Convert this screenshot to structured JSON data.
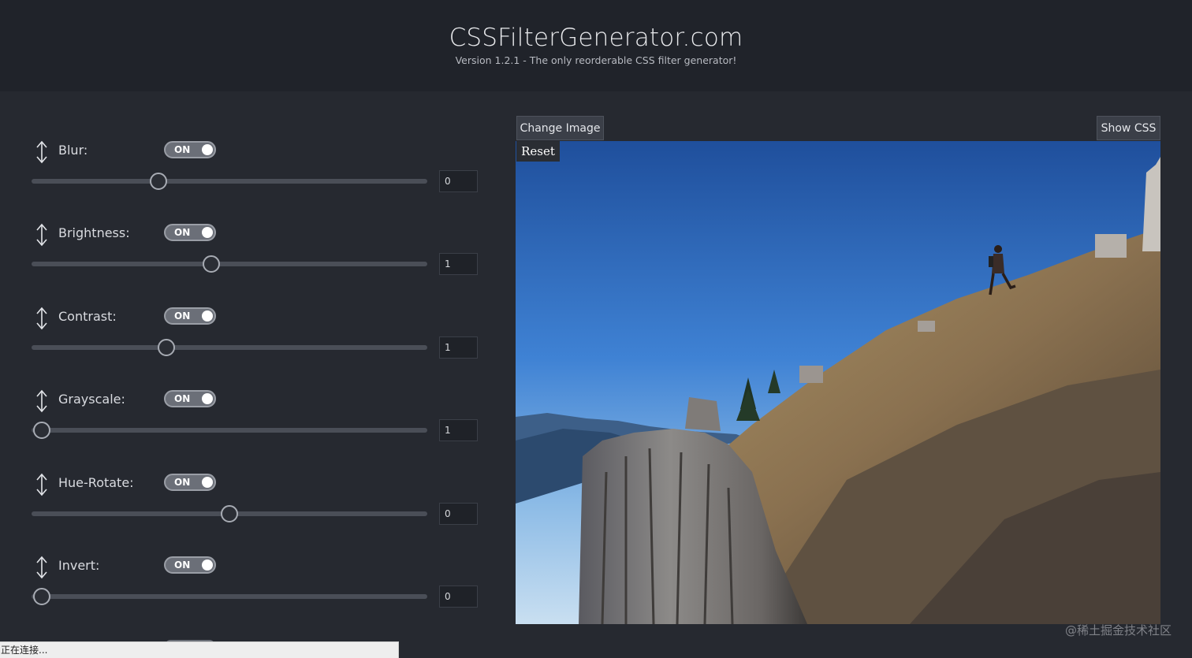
{
  "header": {
    "title": "CSSFilterGenerator.com",
    "subtitle": "Version 1.2.1 - The only reorderable CSS filter generator!"
  },
  "filters": [
    {
      "label": "Blur:",
      "toggle": "ON",
      "value": "0",
      "slider_fraction": 0.32
    },
    {
      "label": "Brightness:",
      "toggle": "ON",
      "value": "1",
      "slider_fraction": 0.455
    },
    {
      "label": "Contrast:",
      "toggle": "ON",
      "value": "1",
      "slider_fraction": 0.34
    },
    {
      "label": "Grayscale:",
      "toggle": "ON",
      "value": "1",
      "slider_fraction": 0.025
    },
    {
      "label": "Hue-Rotate:",
      "toggle": "ON",
      "value": "0",
      "slider_fraction": 0.5
    },
    {
      "label": "Invert:",
      "toggle": "ON",
      "value": "0",
      "slider_fraction": 0.025
    }
  ],
  "preview": {
    "change_image_label": "Change Image",
    "show_css_label": "Show CSS",
    "reset_label": "Reset"
  },
  "status_bar": "正在连接...",
  "watermark": "@稀土掘金技术社区",
  "icons": {
    "drag": "vertical-double-arrow-icon"
  },
  "colors": {
    "header_bg": "#20232a",
    "page_bg": "#262930",
    "toggle_bg": "#6b6f78",
    "track": "#4a4e57"
  }
}
